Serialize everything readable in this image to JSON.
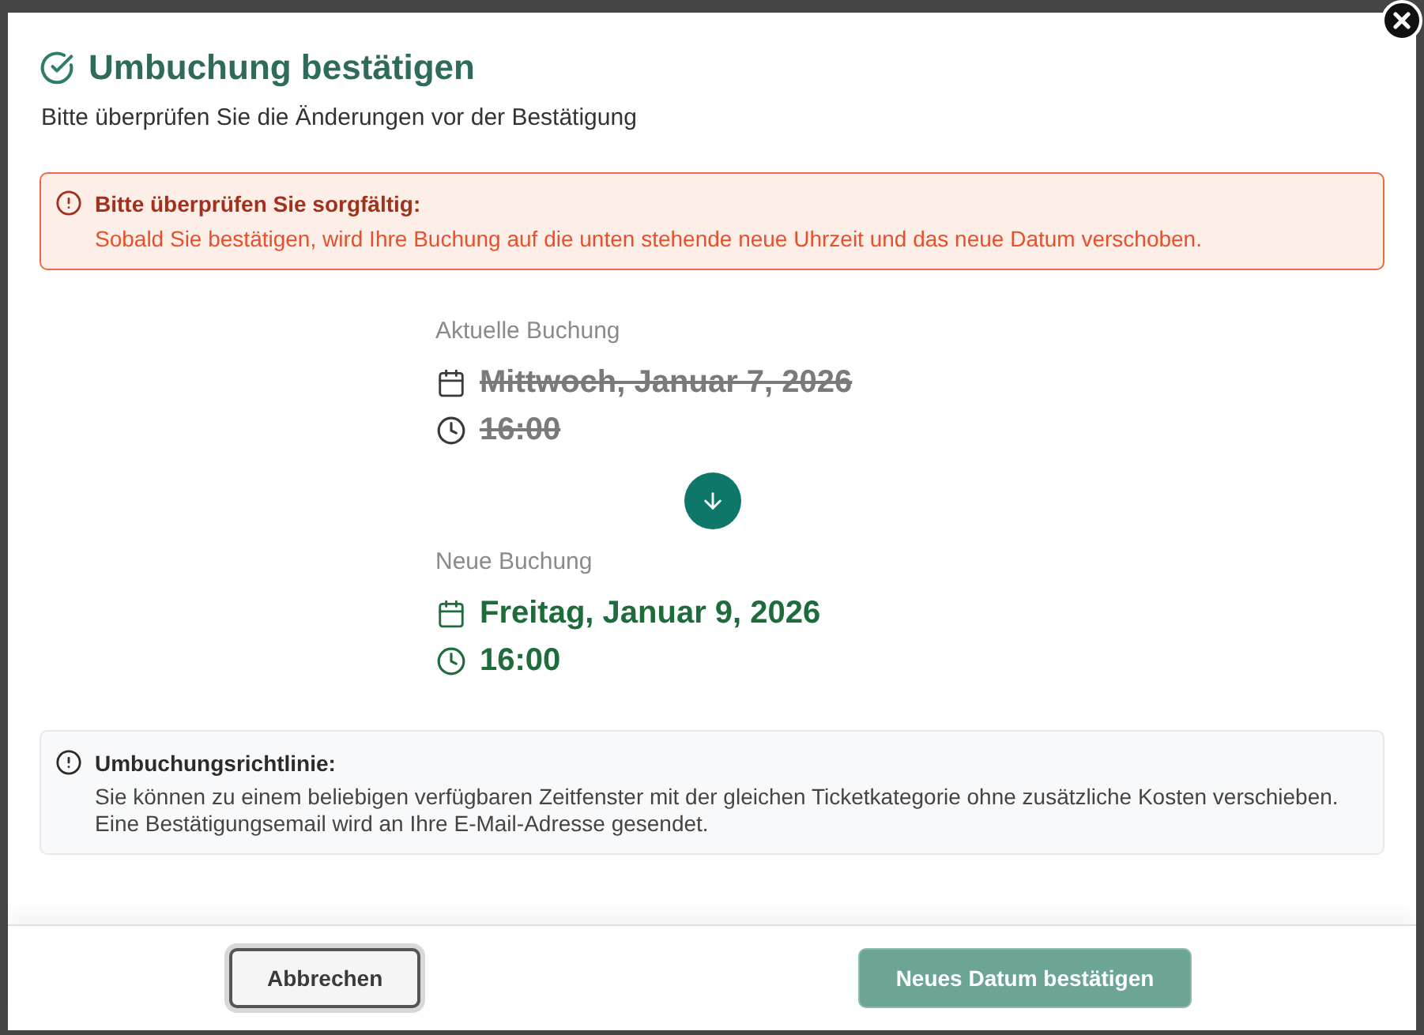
{
  "dialog": {
    "title": "Umbuchung bestätigen",
    "subtitle": "Bitte überprüfen Sie die Änderungen vor der Bestätigung"
  },
  "warning": {
    "title": "Bitte überprüfen Sie sorgfältig:",
    "message": "Sobald Sie bestätigen, wird Ihre Buchung auf die unten stehende neue Uhrzeit und das neue Datum verschoben."
  },
  "bookings": [
    {
      "kind": "current",
      "label": "Aktuelle Buchung",
      "date": "Mittwoch, Januar 7, 2026",
      "time": "16:00"
    },
    {
      "kind": "new",
      "label": "Neue Buchung",
      "date": "Freitag, Januar 9, 2026",
      "time": "16:00"
    }
  ],
  "policy": {
    "title": "Umbuchungsrichtlinie:",
    "lines": [
      "Sie können zu einem beliebigen verfügbaren Zeitfenster mit der gleichen Ticketkategorie ohne zusätzliche Kosten verschieben.",
      "Eine Bestätigungsemail wird an Ihre E-Mail-Adresse gesendet."
    ]
  },
  "buttons": [
    {
      "kind": "secondary",
      "label": "Abbrechen"
    },
    {
      "kind": "primary",
      "label": "Neues Datum bestätigen"
    }
  ]
}
